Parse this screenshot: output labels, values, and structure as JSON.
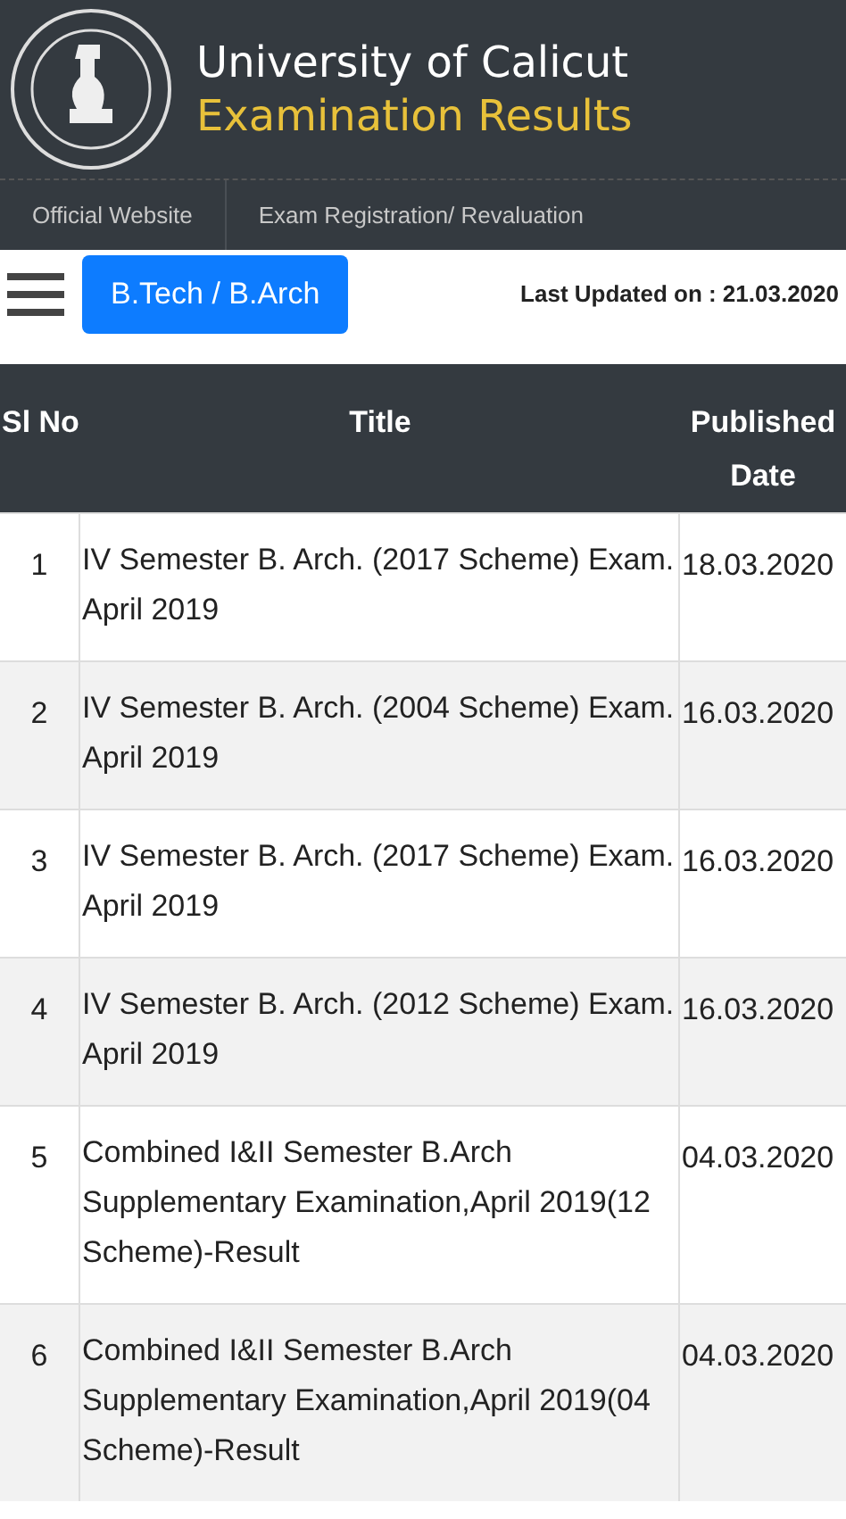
{
  "header": {
    "title": "University of Calicut",
    "subtitle": "Examination Results"
  },
  "nav": [
    {
      "label": "Official Website"
    },
    {
      "label": "Exam Registration/ Revaluation"
    }
  ],
  "toolbar": {
    "category_button": "B.Tech / B.Arch",
    "last_updated": "Last Updated on : 21.03.2020"
  },
  "table": {
    "columns": [
      "Sl No",
      "Title",
      "Published Date"
    ],
    "rows": [
      {
        "sl_no": "1",
        "title": "IV Semester B. Arch. (2017 Scheme) Exam. April 2019",
        "date": "18.03.2020"
      },
      {
        "sl_no": "2",
        "title": "IV Semester B. Arch. (2004 Scheme) Exam. April 2019",
        "date": "16.03.2020"
      },
      {
        "sl_no": "3",
        "title": "IV Semester B. Arch. (2017 Scheme) Exam. April 2019",
        "date": "16.03.2020"
      },
      {
        "sl_no": "4",
        "title": "IV Semester B. Arch. (2012 Scheme) Exam. April 2019",
        "date": "16.03.2020"
      },
      {
        "sl_no": "5",
        "title": "Combined I&II Semester B.Arch Supplementary Examination,April 2019(12 Scheme)-Result",
        "date": "04.03.2020"
      },
      {
        "sl_no": "6",
        "title": "Combined I&II Semester B.Arch Supplementary Examination,April 2019(04 Scheme)-Result",
        "date": "04.03.2020"
      }
    ]
  }
}
